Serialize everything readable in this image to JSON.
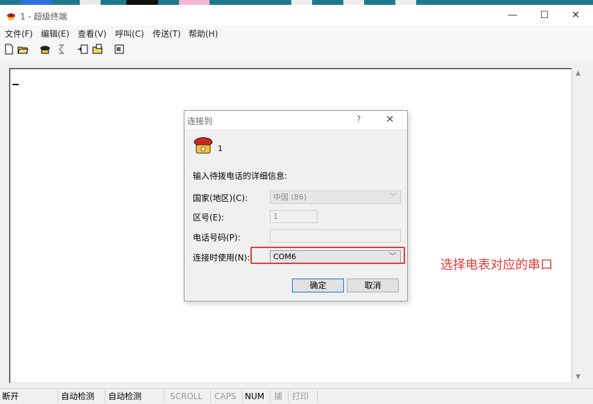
{
  "window": {
    "title": "1 - 超级终端",
    "minimize": "—",
    "maximize": "☐",
    "close": "✕"
  },
  "menu": [
    {
      "label": "文件(F)"
    },
    {
      "label": "编辑(E)"
    },
    {
      "label": "查看(V)"
    },
    {
      "label": "呼叫(C)"
    },
    {
      "label": "传送(T)"
    },
    {
      "label": "帮助(H)"
    }
  ],
  "toolbar": {
    "icons": [
      "new-icon",
      "open-icon",
      "call-icon",
      "disconnect-icon",
      "send-icon",
      "receive-icon",
      "properties-icon"
    ]
  },
  "dialog": {
    "title": "连接到",
    "help": "?",
    "close": "✕",
    "connection_name": "1",
    "instruction": "输入待拨电话的详细信息:",
    "country_label": "国家(地区)(C):",
    "country_value": "中国 (86)",
    "area_label": "区号(E):",
    "area_value": "1",
    "phone_label": "电话号码(P):",
    "phone_value": "",
    "connect_label": "连接时使用(N):",
    "connect_value": "COM6",
    "ok": "确定",
    "cancel": "取消"
  },
  "annotation": "选择电表对应的串口",
  "status": {
    "state": "断开",
    "detect1": "自动检测",
    "detect2": "自动检测",
    "scroll": "SCROLL",
    "caps": "CAPS",
    "num": "NUM",
    "capture": "捕",
    "print": "打印"
  },
  "colors": {
    "accent_red": "#e53935",
    "primary_border": "#0078d7"
  }
}
